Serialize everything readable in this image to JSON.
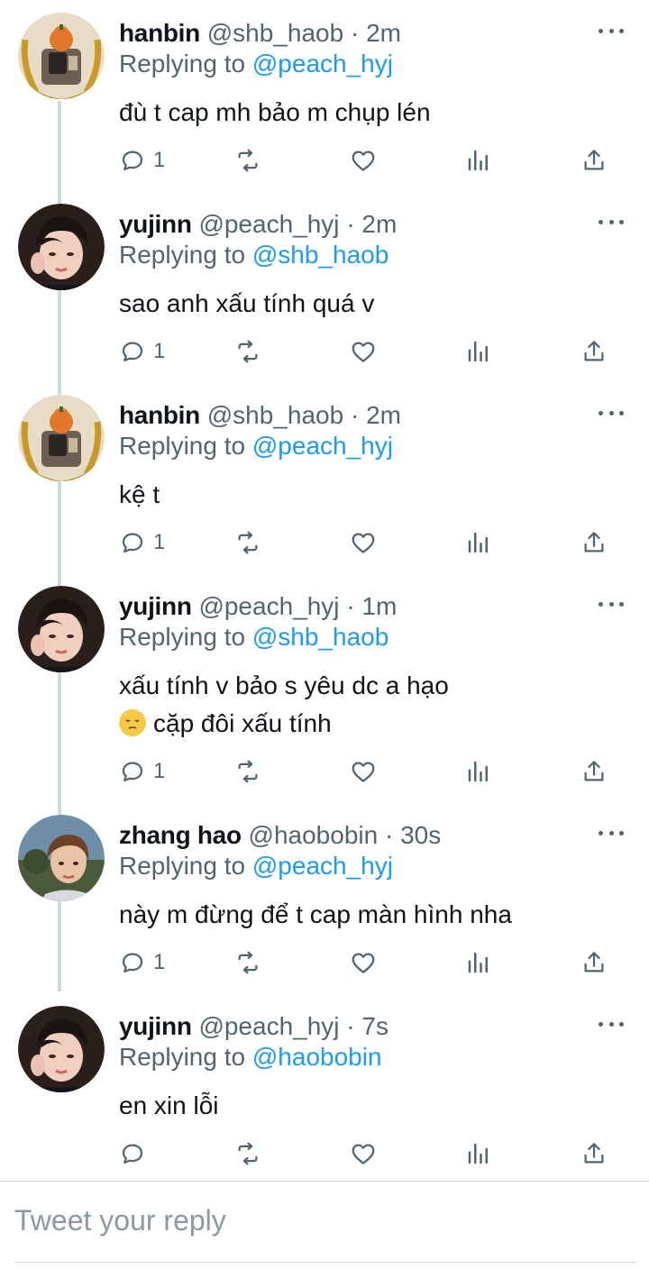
{
  "tweets": [
    {
      "name": "hanbin",
      "handle": "@shb_haob",
      "sep": "·",
      "time": "2m",
      "reply_prefix": "Replying to ",
      "reply_to": "@peach_hyj",
      "lines": [
        "đù t cap mh bảo m chụp lén"
      ],
      "replies": "1",
      "avatar": "hanbin-avatar"
    },
    {
      "name": "yujinn",
      "handle": "@peach_hyj",
      "sep": "·",
      "time": "2m",
      "reply_prefix": "Replying to ",
      "reply_to": "@shb_haob",
      "lines": [
        "sao anh xấu tính quá v"
      ],
      "replies": "1",
      "avatar": "yujinn-avatar"
    },
    {
      "name": "hanbin",
      "handle": "@shb_haob",
      "sep": "·",
      "time": "2m",
      "reply_prefix": "Replying to ",
      "reply_to": "@peach_hyj",
      "lines": [
        "kệ t"
      ],
      "replies": "1",
      "avatar": "hanbin-avatar"
    },
    {
      "name": "yujinn",
      "handle": "@peach_hyj",
      "sep": "·",
      "time": "1m",
      "reply_prefix": "Replying to ",
      "reply_to": "@shb_haob",
      "lines": [
        "xấu tính v bảo s yêu dc a hạo",
        "cặp đôi xấu tính"
      ],
      "emoji_line": 1,
      "emoji": "pensive-face-emoji",
      "replies": "1",
      "avatar": "yujinn-avatar"
    },
    {
      "name": "zhang hao",
      "handle": "@haobobin",
      "sep": "·",
      "time": "30s",
      "reply_prefix": "Replying to ",
      "reply_to": "@peach_hyj",
      "lines": [
        "này m đừng để t cap màn hình nha"
      ],
      "replies": "1",
      "avatar": "zhanghao-avatar"
    },
    {
      "name": "yujinn",
      "handle": "@peach_hyj",
      "sep": "·",
      "time": "7s",
      "reply_prefix": "Replying to ",
      "reply_to": "@haobobin",
      "lines": [
        "en xin lỗi"
      ],
      "replies": "",
      "avatar": "yujinn-avatar"
    }
  ],
  "action_icons": [
    "reply-icon",
    "retweet-icon",
    "like-icon",
    "views-icon",
    "share-icon"
  ],
  "compose": {
    "placeholder": "Tweet your reply",
    "value": ""
  },
  "colors": {
    "link": "#1d9bf0",
    "secondary": "#536471",
    "text": "#0f1419",
    "thread_line": "#cfd9de",
    "emoji": "#f7c948"
  }
}
